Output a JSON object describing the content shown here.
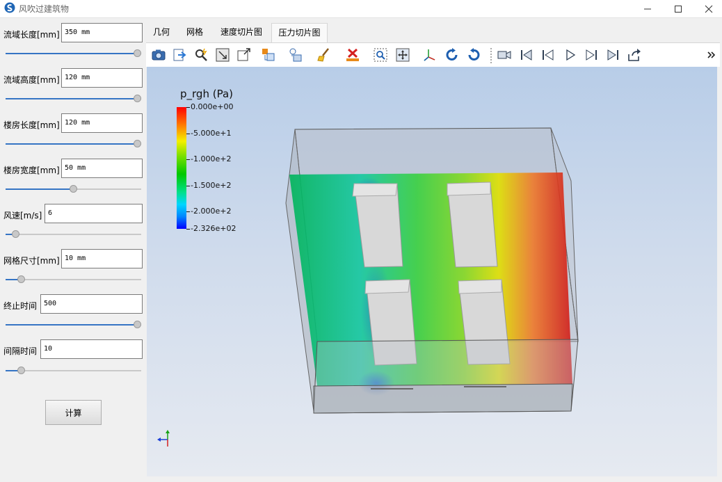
{
  "window": {
    "title": "风吹过建筑物",
    "min_icon": "minimize-icon",
    "max_icon": "maximize-icon",
    "close_icon": "close-icon"
  },
  "params": [
    {
      "label": "流域长度[mm]",
      "value": "350 mm",
      "slider": 1.0
    },
    {
      "label": "流域高度[mm]",
      "value": "120 mm",
      "slider": 1.0
    },
    {
      "label": "楼房长度[mm]",
      "value": "120 mm",
      "slider": 1.0
    },
    {
      "label": "楼房宽度[mm]",
      "value": "50 mm",
      "slider": 0.5
    },
    {
      "label": "风速[m/s]",
      "value": "6",
      "slider": 0.05
    },
    {
      "label": "网格尺寸[mm]",
      "value": "10 mm",
      "slider": 0.09
    },
    {
      "label": "终止时间",
      "value": "500",
      "slider": 1.0
    },
    {
      "label": "间隔时间",
      "value": "10",
      "slider": 0.09
    }
  ],
  "calc_button": "计算",
  "tabs": [
    {
      "label": "几何",
      "active": false
    },
    {
      "label": "网格",
      "active": false
    },
    {
      "label": "速度切片图",
      "active": false
    },
    {
      "label": "压力切片图",
      "active": true
    }
  ],
  "toolbar_icons": [
    "screenshot-camera-icon",
    "export-icon",
    "interactive-select-icon",
    "reset-camera-icon",
    "zoom-box-icon",
    "view-orientation-icon",
    "lighting-icon",
    "paint-brush-icon",
    "delete-icon",
    "zoom-to-data-icon",
    "center-icon",
    "axes-orientation-icon",
    "rotate-left-icon",
    "rotate-right-icon",
    "record-camera-icon",
    "first-frame-icon",
    "previous-frame-icon",
    "play-icon",
    "next-frame-icon",
    "last-frame-icon",
    "loop-icon",
    "more-icon"
  ],
  "legend": {
    "title": "p_rgh (Pa)",
    "ticks": [
      "0.000e+00",
      "-5.000e+1",
      "-1.000e+2",
      "-1.500e+2",
      "-2.000e+2",
      "-2.326e+02"
    ],
    "tick_values": [
      0,
      -50,
      -100,
      -150,
      -200,
      -232.6
    ],
    "range": [
      -232.6,
      0
    ],
    "colors": [
      "#ff0000",
      "#f4f000",
      "#00c800",
      "#00d6ff",
      "#0000ff"
    ]
  },
  "axes_icon": "axes-triad-icon"
}
